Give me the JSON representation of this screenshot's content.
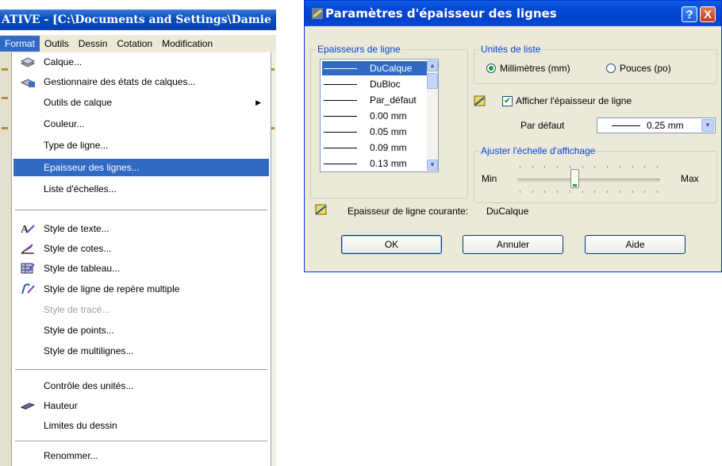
{
  "app_window": {
    "title": "ATIVE - [C:\\Documents and Settings\\Damie",
    "menubar": [
      "Format",
      "Outils",
      "Dessin",
      "Cotation",
      "Modification"
    ]
  },
  "format_menu": {
    "items": [
      {
        "label": "Calque...",
        "icon": "layers-icon"
      },
      {
        "label": "Gestionnaire des états de calques...",
        "icon": "layer-states-icon"
      },
      {
        "label": "Outils de calque",
        "submenu": true
      },
      {
        "label": "Couleur..."
      },
      {
        "label": "Type de ligne..."
      },
      {
        "label": "Epaisseur des lignes...",
        "highlighted": true
      },
      {
        "label": "Liste d'échelles..."
      },
      {
        "label": "Style de texte...",
        "icon": "text-style-icon"
      },
      {
        "label": "Style de cotes...",
        "icon": "dimension-style-icon"
      },
      {
        "label": "Style de tableau...",
        "icon": "table-style-icon"
      },
      {
        "label": "Style de ligne de repère multiple",
        "icon": "multileader-style-icon"
      },
      {
        "label": "Style de tracé...",
        "disabled": true
      },
      {
        "label": "Style de points..."
      },
      {
        "label": "Style de multilignes..."
      },
      {
        "label": "Contrôle des unités..."
      },
      {
        "label": "Hauteur",
        "icon": "thickness-icon"
      },
      {
        "label": "Limites du dessin"
      },
      {
        "label": "Renommer..."
      }
    ]
  },
  "dialog": {
    "title": "Paramètres d'épaisseur des lignes",
    "help_button": "?",
    "close_button": "X",
    "lineweights_group": {
      "title": "Epaisseurs de ligne",
      "items": [
        "DuCalque",
        "DuBloc",
        "Par_défaut",
        "0.00 mm",
        "0.05 mm",
        "0.09 mm",
        "0.13 mm"
      ],
      "selected": "DuCalque"
    },
    "units_group": {
      "title": "Unités de liste",
      "option_mm": "Millimètres (mm)",
      "option_in": "Pouces (po)",
      "selected": "mm"
    },
    "display_checkbox": {
      "label": "Afficher l'épaisseur de ligne",
      "checked": true
    },
    "default": {
      "label": "Par défaut",
      "value": "0.25 mm"
    },
    "scale_group": {
      "title": "Ajuster l'échelle d'affichage",
      "min_label": "Min",
      "max_label": "Max",
      "slider_value": 0.4
    },
    "current": {
      "label": "Epaisseur de ligne courante:",
      "value": "DuCalque"
    },
    "buttons": {
      "ok": "OK",
      "cancel": "Annuler",
      "help": "Aide"
    }
  },
  "colors": {
    "xp_blue": "#0548d8",
    "highlight": "#316ac5",
    "group_title": "#0046d5",
    "dialog_bg": "#ece9d8"
  }
}
